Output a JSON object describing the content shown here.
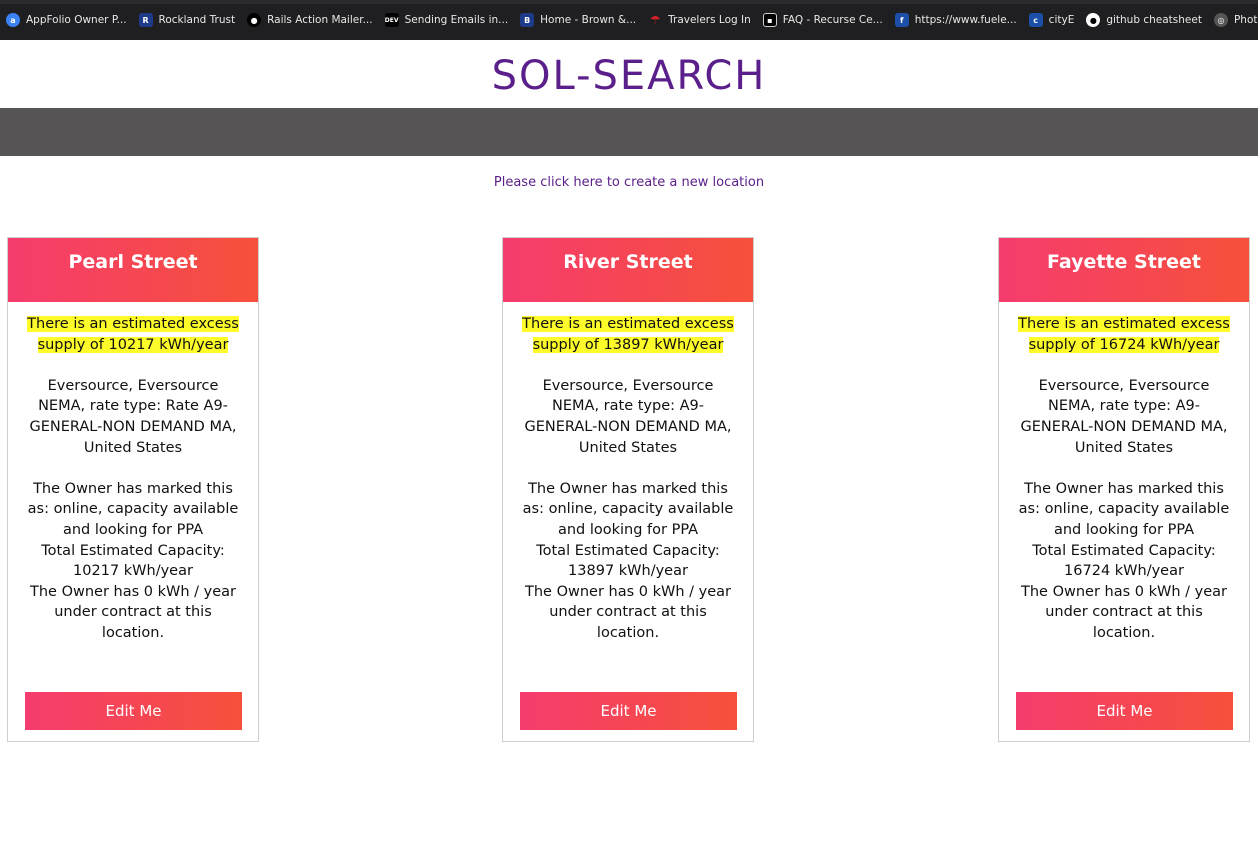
{
  "bookmarks": [
    {
      "label": "AppFolio Owner P...",
      "icon": "appfolio-icon",
      "color": "#3b82f6"
    },
    {
      "label": "Rockland Trust",
      "icon": "rockland-icon",
      "color": "#1e3a8a"
    },
    {
      "label": "Rails Action Mailer...",
      "icon": "medium-icon",
      "color": "#000000"
    },
    {
      "label": "Sending Emails in...",
      "icon": "dev-icon",
      "color": "#000000"
    },
    {
      "label": "Home - Brown &...",
      "icon": "brown-icon",
      "color": "#1e3a8a"
    },
    {
      "label": "Travelers Log In",
      "icon": "travelers-umbrella-icon",
      "color": "#d11f26"
    },
    {
      "label": "FAQ - Recurse Ce...",
      "icon": "recurse-icon",
      "color": "#000000"
    },
    {
      "label": "https://www.fuele...",
      "icon": "fuel-icon",
      "color": "#1e4fa8"
    },
    {
      "label": "cityE",
      "icon": "citye-icon",
      "color": "#1e4fa8"
    },
    {
      "label": "github cheatsheet",
      "icon": "github-icon",
      "color": "#000000"
    },
    {
      "label": "Photo G",
      "icon": "photo-icon",
      "color": "#555555"
    }
  ],
  "logo": {
    "text": "SOL-SEARCH",
    "color": "#5a1f8a"
  },
  "create_link": {
    "text": "Please click here to create a new location"
  },
  "colors": {
    "accent_start": "#f53c6e",
    "accent_end": "#f7503a",
    "highlight": "#fdfb2a",
    "graybar": "#575555"
  },
  "locations": [
    {
      "title": "Pearl Street",
      "excess": "There is an estimated excess supply of 10217 kWh/year",
      "utility": "Eversource, Eversource NEMA, rate type: Rate A9-GENERAL-NON DEMAND MA, United States",
      "status": "The Owner has marked this as: online, capacity available and looking for PPA",
      "capacity": "Total Estimated Capacity: 10217 kWh/year",
      "contract": "The Owner has 0 kWh / year under contract at this location.",
      "button": "Edit Me"
    },
    {
      "title": "River Street",
      "excess": "There is an estimated excess supply of 13897 kWh/year",
      "utility": "Eversource, Eversource NEMA, rate type: A9-GENERAL-NON DEMAND MA, United States",
      "status": "The Owner has marked this as: online, capacity available and looking for PPA",
      "capacity": "Total Estimated Capacity: 13897 kWh/year",
      "contract": "The Owner has 0 kWh / year under contract at this location.",
      "button": "Edit Me"
    },
    {
      "title": "Fayette Street",
      "excess": "There is an estimated excess supply of 16724 kWh/year",
      "utility": "Eversource, Eversource NEMA, rate type: A9-GENERAL-NON DEMAND MA, United States",
      "status": "The Owner has marked this as: online, capacity available and looking for PPA",
      "capacity": "Total Estimated Capacity: 16724 kWh/year",
      "contract": "The Owner has 0 kWh / year under contract at this location.",
      "button": "Edit Me"
    }
  ]
}
